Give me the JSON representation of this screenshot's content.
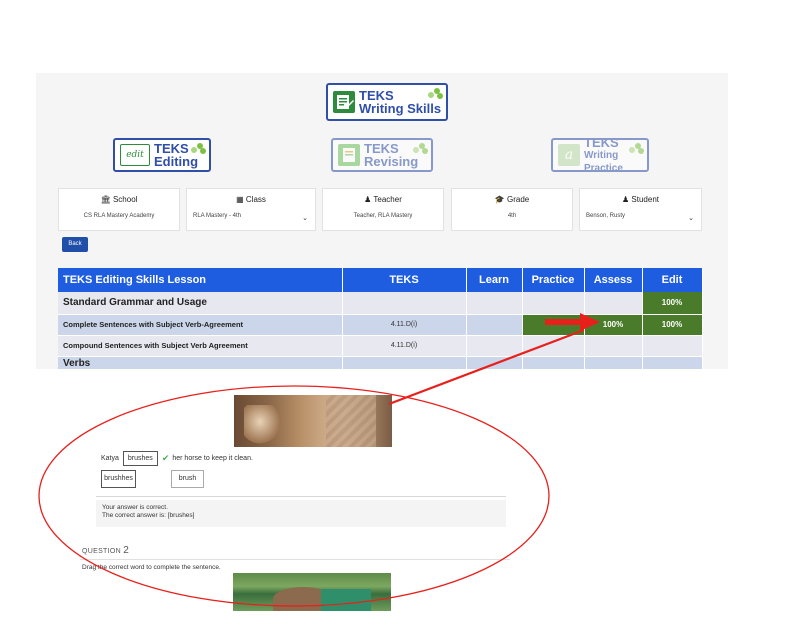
{
  "logos": {
    "main": {
      "line1": "TEKS",
      "line2": "Writing Skills"
    },
    "editing": {
      "badge": "edit",
      "line1": "TEKS",
      "line2": "Editing"
    },
    "revising": {
      "line1": "TEKS",
      "line2": "Revising"
    },
    "practice": {
      "badge": "a",
      "line1": "TEKS",
      "line2": "Writing Practice"
    }
  },
  "filters": {
    "school": {
      "label": "School",
      "value": "CS RLA Mastery Academy",
      "icon": "institution-icon"
    },
    "class": {
      "label": "Class",
      "value": "RLA Mastery - 4th",
      "icon": "id-card-icon"
    },
    "teacher": {
      "label": "Teacher",
      "value": "Teacher, RLA Mastery",
      "icon": "user-icon"
    },
    "grade": {
      "label": "Grade",
      "value": "4th",
      "icon": "graduation-cap-icon"
    },
    "student": {
      "label": "Student",
      "value": "Benson, Rusty",
      "icon": "user-icon"
    }
  },
  "back_label": "Back",
  "table": {
    "headers": [
      "TEKS Editing Skills Lesson",
      "TEKS",
      "Learn",
      "Practice",
      "Assess",
      "Edit"
    ],
    "rows": [
      {
        "type": "category",
        "lesson": "Standard Grammar and Usage",
        "teks": "",
        "learn": "",
        "practice": "",
        "assess": "",
        "edit": "100%"
      },
      {
        "type": "lesson",
        "lesson": "Complete Sentences with Subject Verb-Agreement",
        "teks": "4.11.D(i)",
        "learn": "",
        "practice": "",
        "assess": "100%",
        "edit": "100%"
      },
      {
        "type": "lesson",
        "lesson": "Compound Sentences with Subject Verb Agreement",
        "teks": "4.11.D(i)",
        "learn": "",
        "practice": "",
        "assess": "",
        "edit": ""
      },
      {
        "type": "category",
        "lesson": "Verbs",
        "teks": "",
        "learn": "",
        "practice": "",
        "assess": "",
        "edit": ""
      }
    ]
  },
  "question1": {
    "sentence_start": "Katya",
    "answer": "brushes",
    "sentence_end": "her horse to keep it clean.",
    "choices": [
      "brushhes",
      "brush"
    ],
    "feedback_line1": "Your answer is correct.",
    "feedback_line2": "The correct answer is: [brushes]"
  },
  "question2": {
    "label": "QUESTION",
    "number": "2",
    "instruction": "Drag the correct word to complete the sentence."
  },
  "colors": {
    "header_blue": "#1f5de0",
    "score_green": "#4a7b2a",
    "annotation_red": "#e8201c",
    "logo_blue": "#2f4fa8"
  }
}
